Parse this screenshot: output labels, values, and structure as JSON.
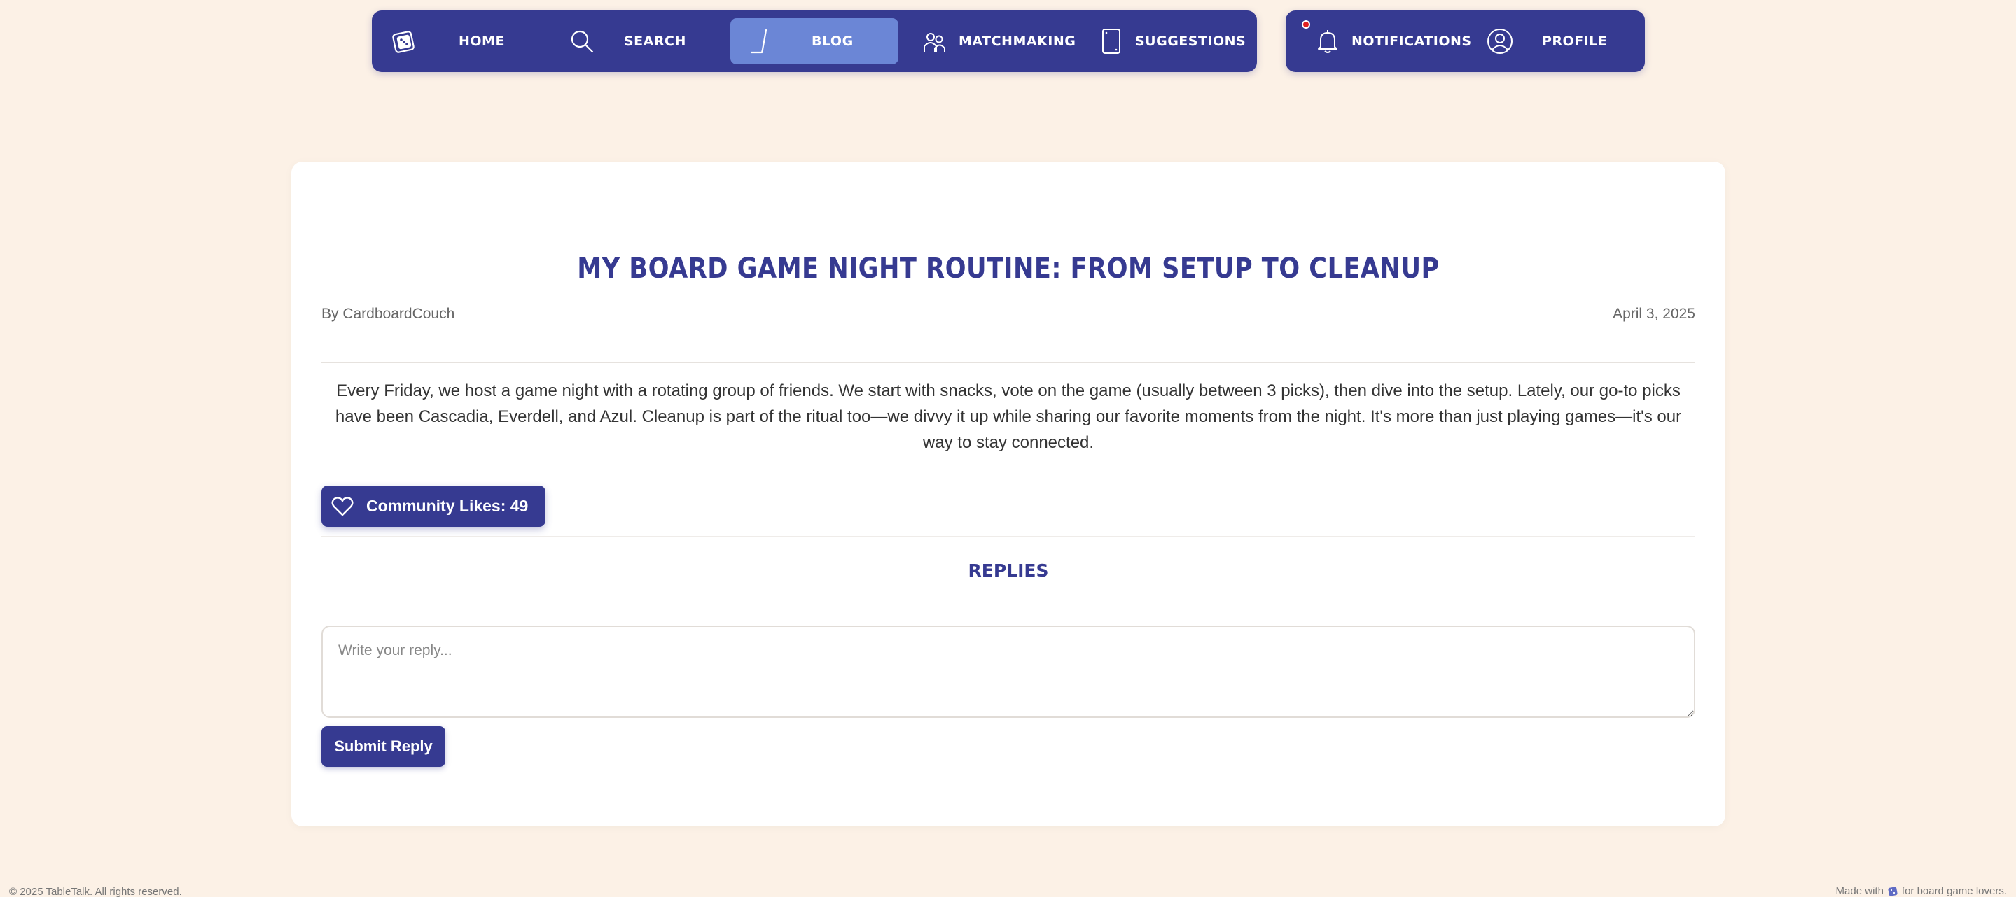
{
  "nav": {
    "items": [
      {
        "label": "HOME",
        "icon": "dice-card-icon"
      },
      {
        "label": "SEARCH",
        "icon": "search-icon"
      },
      {
        "label": "BLOG",
        "icon": "pen-icon",
        "active": true
      },
      {
        "label": "MATCHMAKING",
        "icon": "people-icon"
      },
      {
        "label": "SUGGESTIONS",
        "icon": "card-icon"
      }
    ],
    "secondary": [
      {
        "label": "NOTIFICATIONS",
        "icon": "bell-icon",
        "has_dot": true
      },
      {
        "label": "PROFILE",
        "icon": "user-circle-icon"
      }
    ]
  },
  "post": {
    "title": "MY BOARD GAME NIGHT ROUTINE: FROM SETUP TO CLEANUP",
    "author": "By CardboardCouch",
    "date": "April 3, 2025",
    "body": "Every Friday, we host a game night with a rotating group of friends. We start with snacks, vote on the game (usually between 3 picks), then dive into the setup. Lately, our go-to picks have been Cascadia, Everdell, and Azul. Cleanup is part of the ritual too—we divvy it up while sharing our favorite moments from the night. It's more than just playing games—it's our way to stay connected.",
    "likes_label": "Community Likes: 49",
    "likes_icon": "heart-icon"
  },
  "replies": {
    "heading": "REPLIES",
    "placeholder": "Write your reply...",
    "value": "",
    "submit_label": "Submit Reply"
  },
  "footer": {
    "left": "© 2025 TableTalk. All rights reserved.",
    "right_prefix": "Made with",
    "right_icon": "dice-icon",
    "right_suffix": "for board game lovers."
  },
  "colors": {
    "background": "#fcf1e6",
    "primary": "#363a91",
    "active_tab": "#6b86d6",
    "notification_dot": "#e02020"
  }
}
